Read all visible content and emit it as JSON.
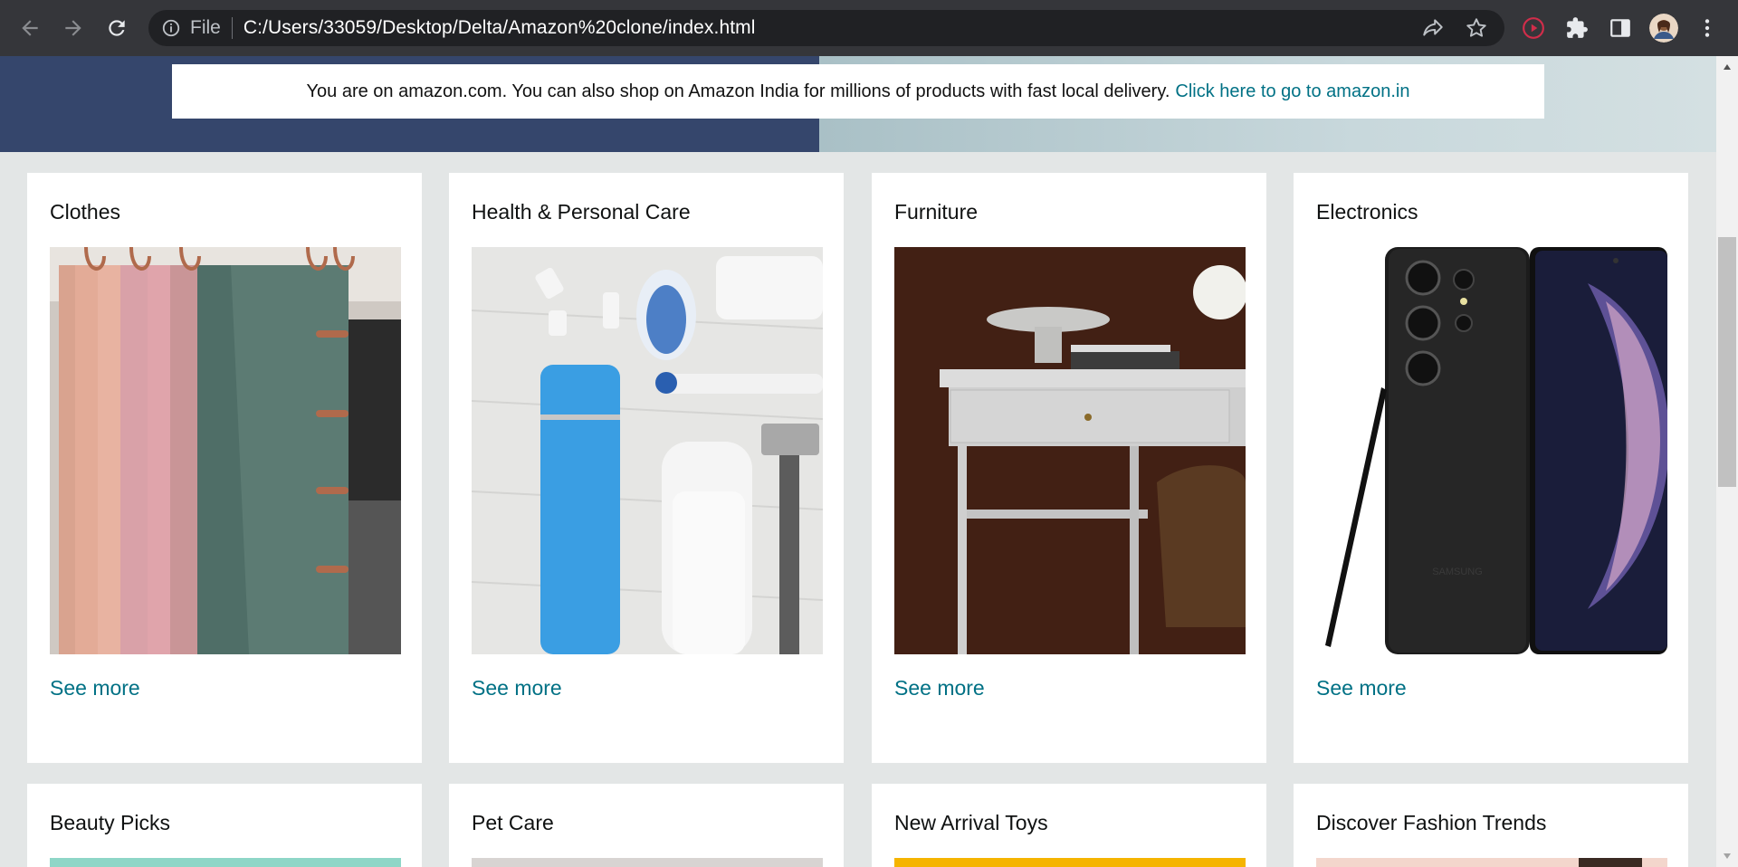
{
  "browser": {
    "back_icon": "arrow-left-icon",
    "forward_icon": "arrow-right-icon",
    "reload_icon": "reload-icon",
    "info_icon": "info-icon",
    "scheme_label": "File",
    "url": "C:/Users/33059/Desktop/Delta/Amazon%20clone/index.html",
    "share_icon": "share-icon",
    "bookmark_icon": "star-icon",
    "extensions": [
      "record-icon",
      "puzzle-icon",
      "side-panel-icon",
      "avatar",
      "kebab-menu-icon"
    ]
  },
  "notice": {
    "text": "You are on amazon.com. You can also shop on Amazon India for millions of products with fast local delivery.",
    "link": "Click here to go to amazon.in"
  },
  "cards_row1": [
    {
      "title": "Clothes",
      "link": "See more"
    },
    {
      "title": "Health & Personal Care",
      "link": "See more"
    },
    {
      "title": "Furniture",
      "link": "See more"
    },
    {
      "title": "Electronics",
      "link": "See more"
    }
  ],
  "cards_row2": [
    {
      "title": "Beauty Picks"
    },
    {
      "title": "Pet Care"
    },
    {
      "title": "New Arrival Toys"
    },
    {
      "title": "Discover Fashion Trends"
    }
  ],
  "colors": {
    "link": "#007185",
    "hero_left": "#35466c",
    "page_bg": "#e3e6e6"
  }
}
